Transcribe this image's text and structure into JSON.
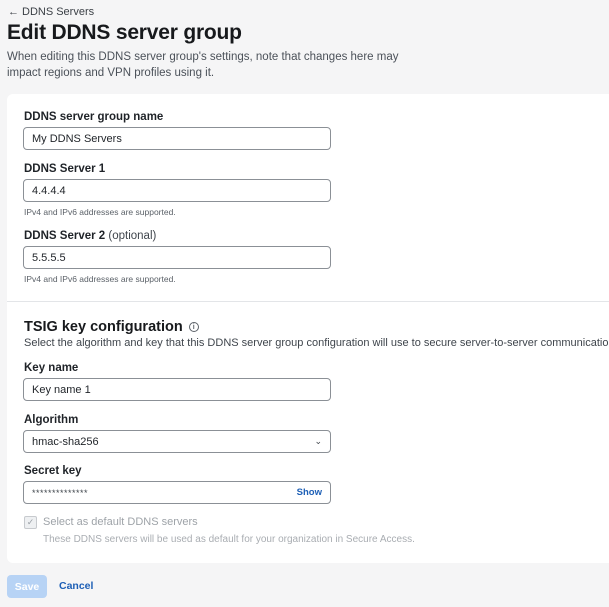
{
  "breadcrumb": {
    "back_label": "DDNS Servers"
  },
  "page": {
    "title": "Edit DDNS server group",
    "description": "When editing this DDNS server group's settings, note that changes here may impact regions and VPN profiles using it."
  },
  "form": {
    "group_name": {
      "label": "DDNS server group name",
      "value": "My DDNS Servers"
    },
    "server1": {
      "label": "DDNS Server 1",
      "value": "4.4.4.4",
      "helper": "IPv4 and IPv6 addresses are supported."
    },
    "server2": {
      "label": "DDNS Server 2",
      "optional": "(optional)",
      "value": "5.5.5.5",
      "helper": "IPv4 and IPv6 addresses are supported."
    }
  },
  "tsig": {
    "title": "TSIG key configuration",
    "description": "Select the algorithm  and key that this DDNS server group configuration will use to secure server-to-server communications.",
    "key_name": {
      "label": "Key name",
      "value": "Key name 1"
    },
    "algorithm": {
      "label": "Algorithm",
      "value": "hmac-sha256"
    },
    "secret": {
      "label": "Secret key",
      "mask": "**************",
      "show_label": "Show"
    }
  },
  "default_option": {
    "label": "Select as default DDNS servers",
    "help": "These DDNS servers will be used as default for your organization in Secure Access.",
    "checked": true
  },
  "actions": {
    "save_label": "Save",
    "cancel_label": "Cancel"
  },
  "colors": {
    "link": "#1d5fb6",
    "save_disabled": "#b7d3f5",
    "background": "#f5f5f6"
  }
}
